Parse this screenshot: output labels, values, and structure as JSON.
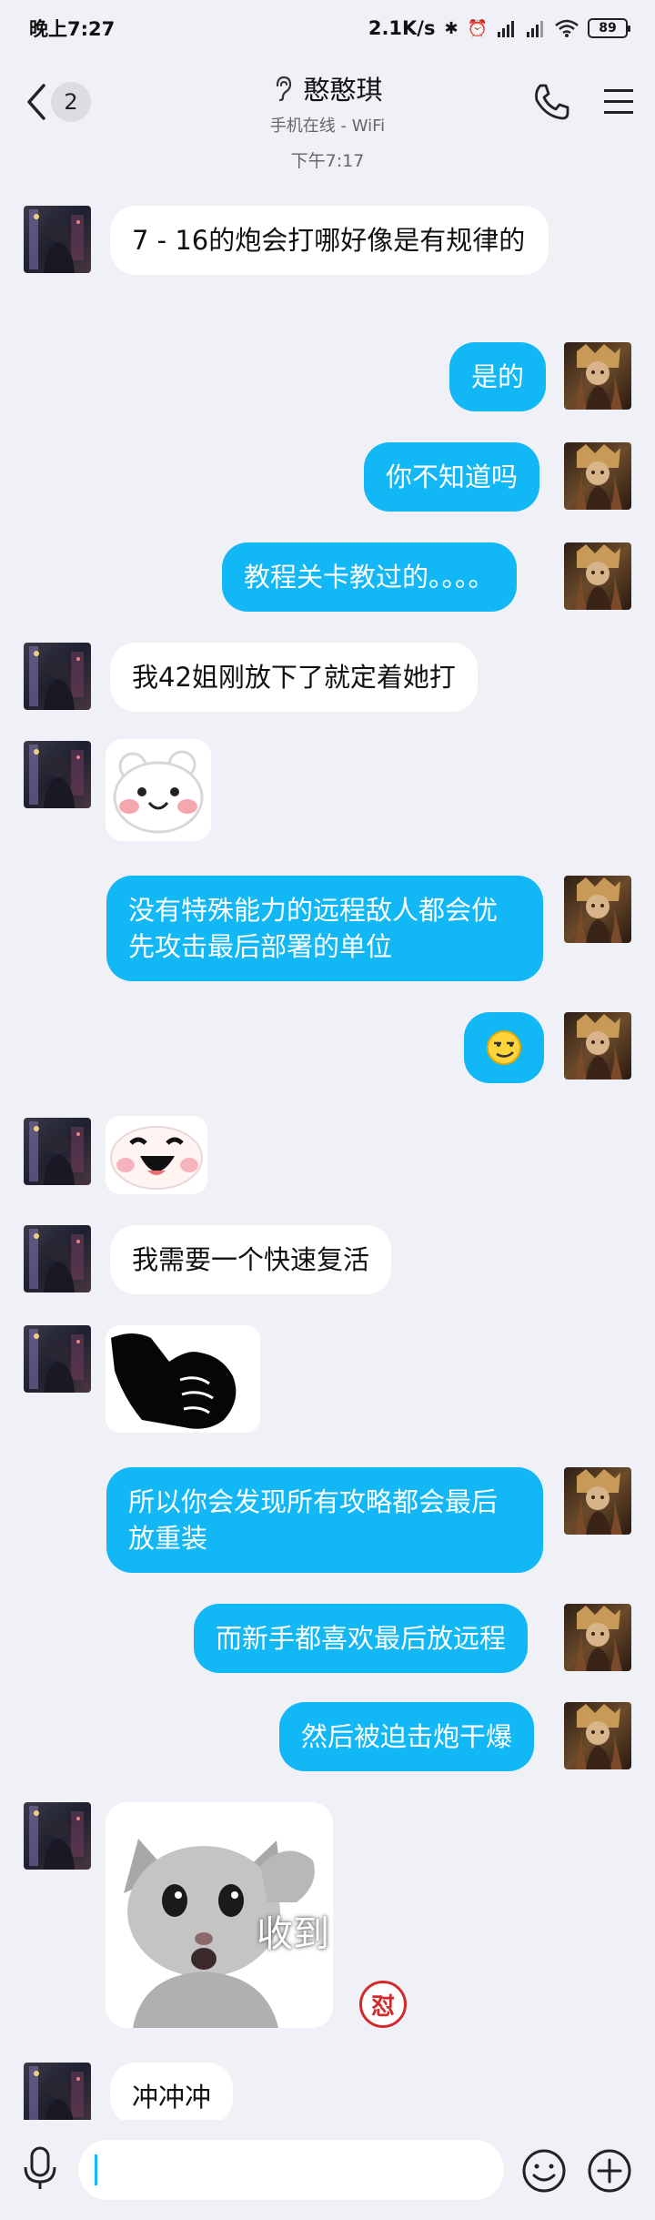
{
  "status_bar": {
    "time": "晚上7:27",
    "net_speed": "2.1K/s",
    "battery": "89"
  },
  "header": {
    "unread_count": "2",
    "title": "憨憨琪",
    "subtitle": "手机在线 - WiFi"
  },
  "chat": {
    "timestamp": "下午7:17",
    "messages": [
      {
        "side": "in",
        "text": "7 - 16的炮会打哪好像是有规律的"
      },
      {
        "side": "out",
        "text": "是的"
      },
      {
        "side": "out",
        "text": "你不知道吗"
      },
      {
        "side": "out",
        "text": "教程关卡教过的。。。。"
      },
      {
        "side": "in",
        "text": "我42姐刚放下了就定着她打"
      },
      {
        "side": "in",
        "sticker": "blushing-bear-sticker"
      },
      {
        "side": "out",
        "text": "没有特殊能力的远程敌人都会优先攻击最后部署的单位"
      },
      {
        "side": "out",
        "sticker": "smirk-emoji"
      },
      {
        "side": "in",
        "sticker": "laughing-face-sticker"
      },
      {
        "side": "in",
        "text": "我需要一个快速复活"
      },
      {
        "side": "in",
        "sticker": "thumbs-up-silhouette-sticker"
      },
      {
        "side": "out",
        "text": "所以你会发现所有攻略都会最后放重装"
      },
      {
        "side": "out",
        "text": "而新手都喜欢最后放远程"
      },
      {
        "side": "out",
        "text": "然后被迫击炮干爆"
      },
      {
        "side": "in",
        "sticker": "salute-cat-sticker",
        "caption": "收到"
      },
      {
        "side": "in",
        "text": "冲冲冲"
      }
    ],
    "reaction": "怼"
  },
  "input": {
    "placeholder": ""
  },
  "colors": {
    "background": "#f0f1f6",
    "outgoing_bubble": "#12b7f5",
    "incoming_bubble": "#ffffff"
  }
}
